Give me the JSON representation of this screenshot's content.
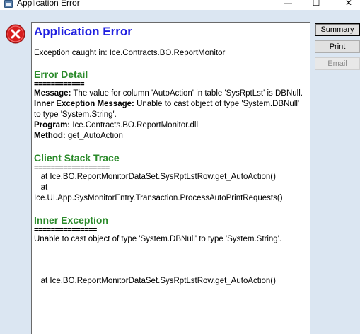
{
  "window": {
    "title": "Application Error",
    "minimize_glyph": "—",
    "maximize_glyph": "☐",
    "close_glyph": "✕"
  },
  "icons": {
    "app": "app-window-icon",
    "error": "error-icon"
  },
  "colors": {
    "title_blue": "#1f1fe0",
    "section_green": "#2a8a2a",
    "error_red": "#d81e1e"
  },
  "content": {
    "title": "Application Error",
    "exception_line": "Exception caught in: Ice.Contracts.BO.ReportMonitor",
    "error_detail": {
      "heading": "Error Detail",
      "separator": "============",
      "message_label": "Message:",
      "message_text": " The value for column 'AutoAction' in table 'SysRptLst' is DBNull.",
      "inner_label": "Inner Exception Message:",
      "inner_text": " Unable to cast object of type 'System.DBNull' to type 'System.String'.",
      "program_label": "Program:",
      "program_text": " Ice.Contracts.BO.ReportMonitor.dll",
      "method_label": "Method:",
      "method_text": " get_AutoAction"
    },
    "client_stack": {
      "heading": "Client Stack Trace",
      "separator": "==================",
      "line1": "   at Ice.BO.ReportMonitorDataSet.SysRptLstRow.get_AutoAction()",
      "line2": "   at",
      "line3": "Ice.UI.App.SysMonitorEntry.Transaction.ProcessAutoPrintRequests()"
    },
    "inner_exception": {
      "heading": "Inner Exception",
      "separator": "===============",
      "text": "Unable to cast object of type 'System.DBNull' to type 'System.String'.",
      "stack_line": "   at Ice.BO.ReportMonitorDataSet.SysRptLstRow.get_AutoAction()"
    }
  },
  "buttons": {
    "summary": "Summary",
    "print": "Print",
    "email": "Email"
  }
}
